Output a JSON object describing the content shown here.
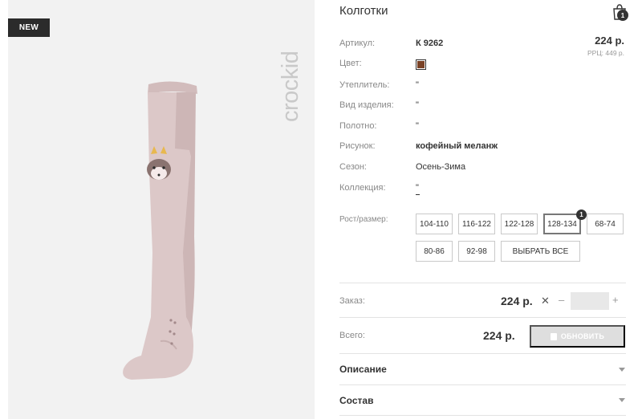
{
  "badge": {
    "new": "NEW"
  },
  "brand": {
    "watermark": "crockid"
  },
  "product": {
    "title": "Колготки",
    "price": "224 р.",
    "rrp": "РРЦ: 449 р."
  },
  "cart": {
    "count": "1"
  },
  "attributes": [
    {
      "label": "Артикул:",
      "value": "К 9262"
    },
    {
      "label": "Цвет:",
      "value": ""
    },
    {
      "label": "Утеплитель:",
      "value": "\""
    },
    {
      "label": "Вид изделия:",
      "value": "\""
    },
    {
      "label": "Полотно:",
      "value": "\""
    },
    {
      "label": "Рисунок:",
      "value": "кофейный меланж"
    },
    {
      "label": "Сезон:",
      "value": "Осень-Зима"
    },
    {
      "label": "Коллекция:",
      "value": "\""
    }
  ],
  "colors": {
    "swatch": "#7a4226",
    "accent": "#333333",
    "button_disabled": "#dedede"
  },
  "sizes": {
    "label": "Рост/размер:",
    "options": [
      "104-110",
      "116-122",
      "122-128",
      "128-134",
      "68-74",
      "80-86",
      "92-98"
    ],
    "selected": "128-134",
    "selected_count": "1",
    "select_all": "ВЫБРАТЬ ВСЕ"
  },
  "order": {
    "label": "Заказ:",
    "price": "224 р.",
    "remove": "✕",
    "minus": "–",
    "plus": "+",
    "quantity": ""
  },
  "total": {
    "label": "Всего:",
    "price": "224 р.",
    "update_button": "ОБНОВИТЬ"
  },
  "accordion": [
    {
      "label": "Описание"
    },
    {
      "label": "Состав"
    }
  ]
}
